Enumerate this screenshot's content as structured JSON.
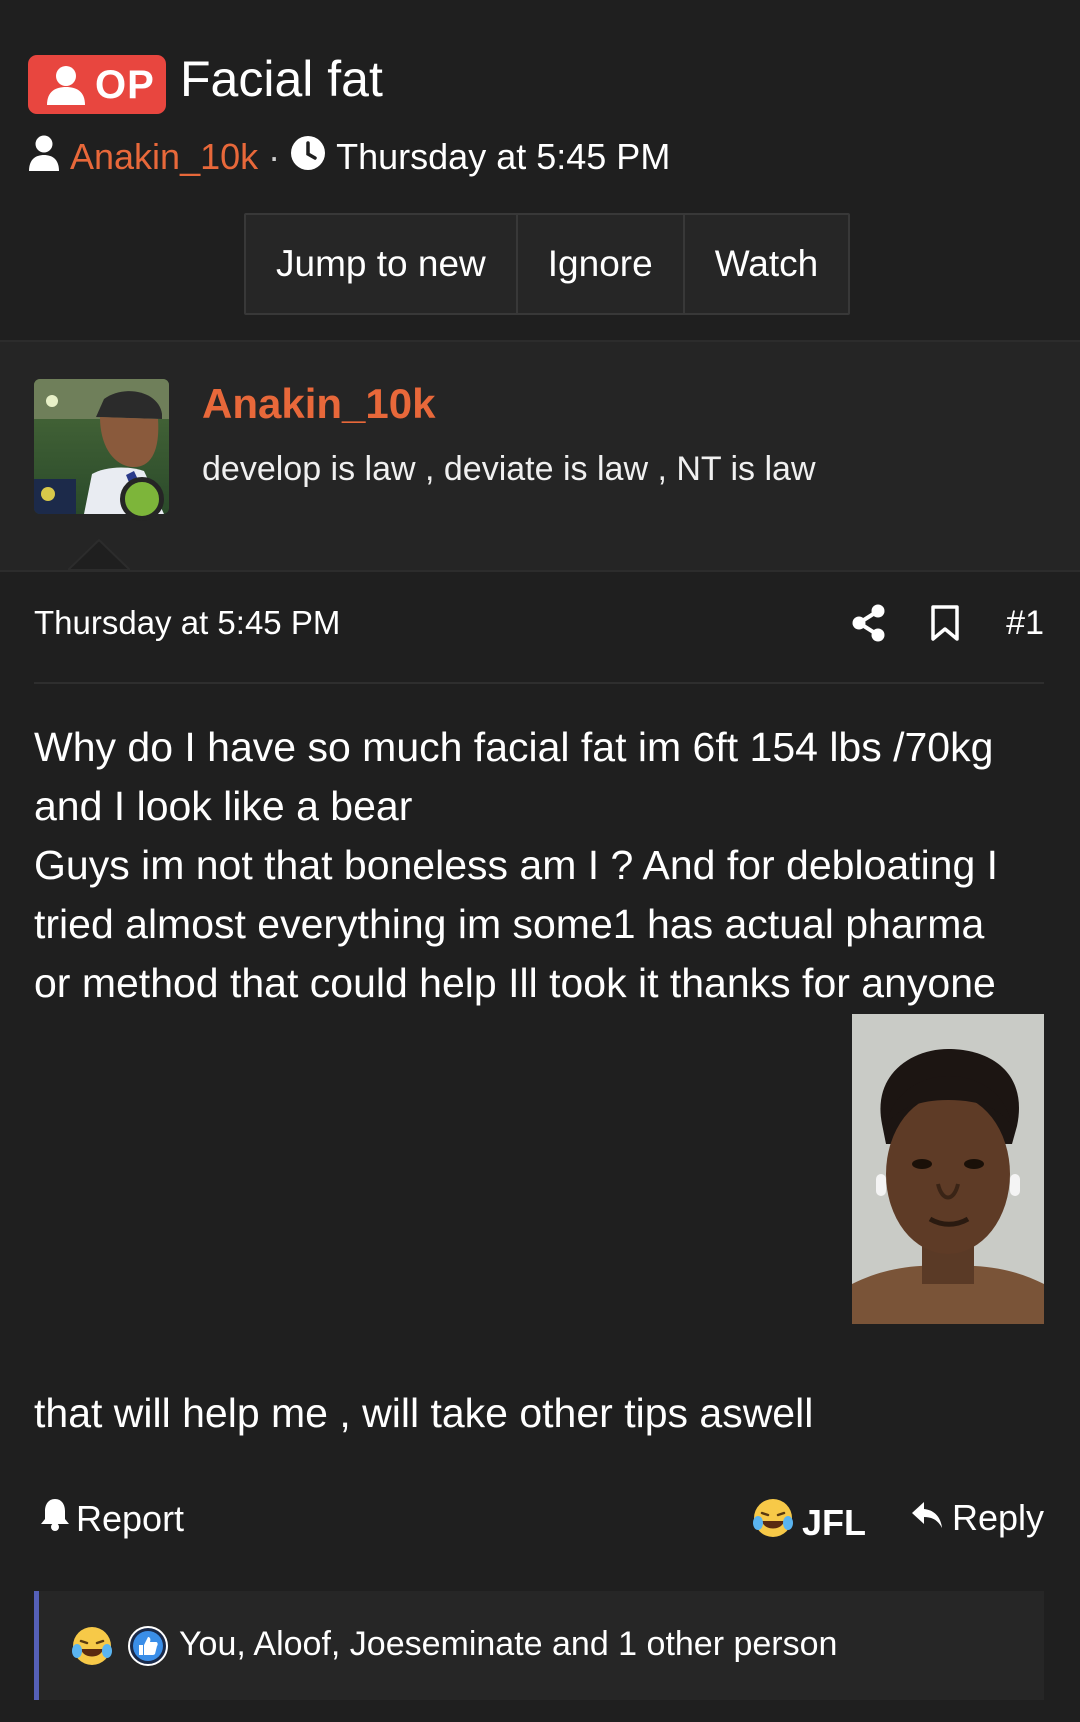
{
  "thread": {
    "op_badge": "OP",
    "title": "Facial fat",
    "author": "Anakin_10k",
    "separator": "·",
    "time": "Thursday at 5:45 PM"
  },
  "thread_buttons": {
    "jump": "Jump to new",
    "ignore": "Ignore",
    "watch": "Watch"
  },
  "author_card": {
    "name": "Anakin_10k",
    "signature": "develop is law , deviate is law , NT is law",
    "online_color": "#7db53a"
  },
  "post": {
    "date": "Thursday at 5:45 PM",
    "number": "#1",
    "body_line1": "Why do I have so much facial fat im 6ft 154 lbs /70kg",
    "body_line2": "and I look like a bear",
    "body_line3": "Guys im not that boneless am I ? And for debloating I",
    "body_line4": "tried almost everything im some1 has actual pharma",
    "body_line5": "or method that could help Ill took it thanks for anyone",
    "body_after_image": "that will help me , will take other tips aswell"
  },
  "actions": {
    "report": "Report",
    "reaction": "JFL",
    "reply": "Reply"
  },
  "reactions": {
    "summary": "You, Aloof, Joeseminate and 1 other person",
    "icons": [
      "crying-laughing-emoji",
      "thumbs-up-icon"
    ]
  },
  "colors": {
    "accent_orange": "#e8683a",
    "op_red": "#e8463f",
    "background": "#1f1f1f",
    "reaction_border": "#5560b8"
  }
}
